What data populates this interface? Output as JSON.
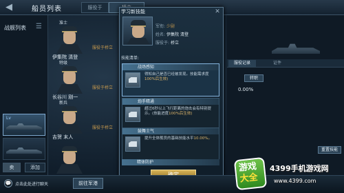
{
  "header": {
    "title": "船员列表",
    "tab_soldiers": "服役于",
    "tab_bridge": "桥立"
  },
  "sidebar": {
    "fleet_label": "战舰列表",
    "transfer": "卖",
    "add": "添加"
  },
  "crew": [
    {
      "rank": "准士",
      "name": "伊集院 清登",
      "assign": "服役于桥立"
    },
    {
      "rank": "特级",
      "name": "长谷川 刚一",
      "assign": "服役于桥立"
    },
    {
      "rank": "新兵",
      "name": "吉贺 末人",
      "assign": "服役于桥立"
    }
  ],
  "modal": {
    "title": "学习新技能",
    "close": "✕",
    "rank_label": "军衔:",
    "rank_value": "少尉",
    "name_label": "姓名:",
    "name_value": "伊集院 清登",
    "service_label": "服役于:",
    "service_value": "桥立",
    "skill_list_label": "技能清单:",
    "skills": [
      {
        "name": "战场感知",
        "desc_1": "得知自己是否已经被发现。技能需求度",
        "desc_2": "100%后生效)"
      },
      {
        "name": "炮手精通",
        "desc_1": "超过6秒以上飞行距离的炮击会有特别提示。(技能进度",
        "desc_2": "100%后生效)"
      },
      {
        "name": "鼓舞士气",
        "desc_1": "提升全体舰员的基础技能水平",
        "desc_2": "10.00%。"
      },
      {
        "name": "精体防护"
      }
    ],
    "confirm": "确定"
  },
  "right_panel": {
    "tab_record": "服役记录",
    "tab_certificate": "证件",
    "transfer": "转职",
    "percent": "0.00%",
    "reset": "重置技能"
  },
  "footer": {
    "chat_icon": "💬",
    "chat_text": "点击此处进行聊天",
    "goto_port": "前往军港"
  },
  "watermark": {
    "badge_1": "游戏",
    "badge_2": "大全",
    "name": "4399手机游戏网",
    "url": "www.4399.com"
  }
}
